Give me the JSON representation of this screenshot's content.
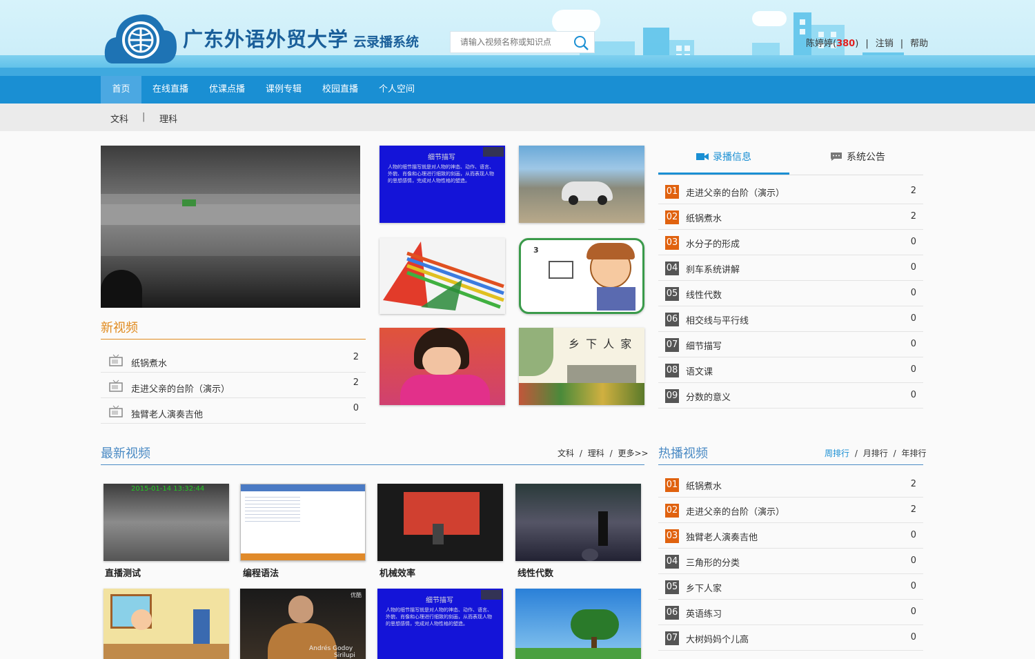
{
  "header": {
    "school_name": "广东外语外贸大学",
    "system_name": "云录播系统",
    "search_placeholder": "请输入视频名称或知识点",
    "user_name": "陈婷婷",
    "user_points": "380",
    "logout": "注销",
    "help": "帮助"
  },
  "nav": {
    "items": [
      {
        "label": "首页"
      },
      {
        "label": "在线直播"
      },
      {
        "label": "优课点播"
      },
      {
        "label": "课例专辑"
      },
      {
        "label": "校园直播"
      },
      {
        "label": "个人空间"
      }
    ]
  },
  "subnav": {
    "liberal": "文科",
    "divider": "|",
    "science": "理科"
  },
  "new_videos": {
    "title": "新视频",
    "items": [
      {
        "title": "纸锅煮水",
        "count": "2"
      },
      {
        "title": "走进父亲的台阶（演示）",
        "count": "2"
      },
      {
        "title": "独臂老人演奏吉他",
        "count": "0"
      }
    ]
  },
  "info_tabs": {
    "recording_info": "录播信息",
    "announcement": "系统公告"
  },
  "ranking": [
    {
      "num": "01",
      "title": "走进父亲的台阶（演示）",
      "count": "2"
    },
    {
      "num": "02",
      "title": "纸锅煮水",
      "count": "2"
    },
    {
      "num": "03",
      "title": "水分子的形成",
      "count": "0"
    },
    {
      "num": "04",
      "title": "刹车系统讲解",
      "count": "0"
    },
    {
      "num": "05",
      "title": "线性代数",
      "count": "0"
    },
    {
      "num": "06",
      "title": "相交线与平行线",
      "count": "0"
    },
    {
      "num": "07",
      "title": "细节描写",
      "count": "0"
    },
    {
      "num": "08",
      "title": "语文课",
      "count": "0"
    },
    {
      "num": "09",
      "title": "分数的意义",
      "count": "0"
    }
  ],
  "latest": {
    "title": "最新视频",
    "link_liberal": "文科",
    "link_science": "理科",
    "link_more": "更多>>",
    "slash": "/",
    "videos": [
      {
        "title": "直播测试",
        "stamp": "2015-01-14 13:32:44"
      },
      {
        "title": "编程语法"
      },
      {
        "title": "机械效率"
      },
      {
        "title": "线性代数"
      }
    ],
    "overlay_singer": "Andrés Godoy",
    "overlay_singer2": "Sirilupi",
    "overlay_badge": "优酷"
  },
  "hot": {
    "title": "热播视频",
    "week": "周排行",
    "month": "月排行",
    "year": "年排行",
    "slash": "/",
    "items": [
      {
        "num": "01",
        "title": "纸锅煮水",
        "count": "2"
      },
      {
        "num": "02",
        "title": "走进父亲的台阶（演示）",
        "count": "2"
      },
      {
        "num": "03",
        "title": "独臂老人演奏吉他",
        "count": "0"
      },
      {
        "num": "04",
        "title": "三角形的分类",
        "count": "0"
      },
      {
        "num": "05",
        "title": "乡下人家",
        "count": "0"
      },
      {
        "num": "06",
        "title": "英语练习",
        "count": "0"
      },
      {
        "num": "07",
        "title": "大树妈妈个儿高",
        "count": "0"
      }
    ]
  },
  "slides": {
    "slide_title": "细节描写",
    "slide_body": "人物的细节描写就是对人物的神态、动作、语言、外貌、肖像和心理进行细致的刻画，从而表现人物的思想感情，完成对人物性格的塑造。",
    "village_title": "乡 下 人 家",
    "cartoon_num": "3"
  },
  "colors": {
    "nav_blue": "#1a8fd3",
    "hot_orange": "#e0620f",
    "section_orange": "#e08a1e",
    "points_red": "#e02020"
  }
}
